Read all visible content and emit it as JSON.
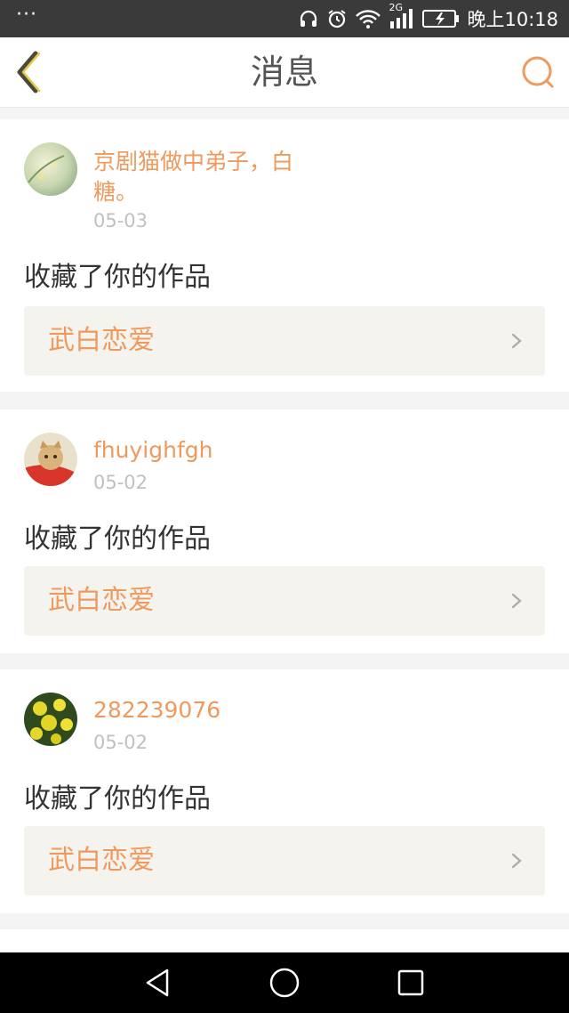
{
  "status_bar": {
    "dots": "···",
    "network": "2G",
    "time": "晚上10:18"
  },
  "header": {
    "title": "消息"
  },
  "icons": {
    "back": "back-chevron-icon",
    "search": "search-icon",
    "headphones": "headphones-icon",
    "alarm": "alarm-icon",
    "wifi": "wifi-icon",
    "signal": "signal-icon",
    "battery": "battery-charging-icon"
  },
  "colors": {
    "accent": "#ee9a5e",
    "status_bar_bg": "#3a3a3a",
    "work_card_bg": "#f5f3ee"
  },
  "messages": [
    {
      "sender": "京剧猫做中弟子，白糖。",
      "date": "05-03",
      "action": "收藏了你的作品",
      "work": "武白恋爱"
    },
    {
      "sender": "fhuyighfgh",
      "date": "05-02",
      "action": "收藏了你的作品",
      "work": "武白恋爱"
    },
    {
      "sender": "282239076",
      "date": "05-02",
      "action": "收藏了你的作品",
      "work": "武白恋爱"
    }
  ]
}
